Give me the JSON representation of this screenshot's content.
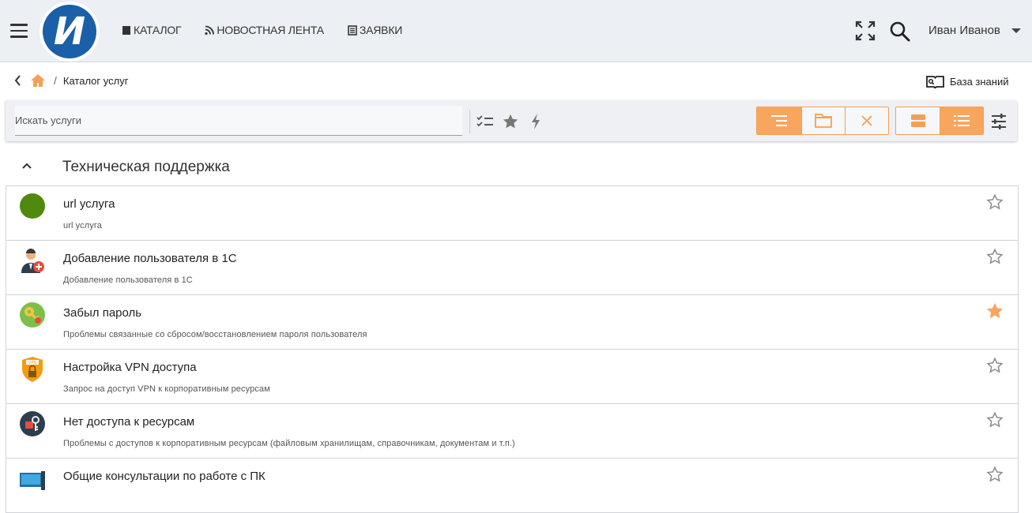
{
  "header": {
    "logo_letter": "И",
    "nav": [
      {
        "label": "КАТАЛОГ",
        "icon": "book-icon"
      },
      {
        "label": "НОВОСТНАЯ ЛЕНТА",
        "icon": "rss-icon"
      },
      {
        "label": "ЗАЯВКИ",
        "icon": "tickets-icon"
      }
    ],
    "user_name": "Иван Иванов"
  },
  "breadcrumb": {
    "current": "Каталог услуг",
    "separator": "/"
  },
  "knowledge_base": {
    "label": "База знаний"
  },
  "toolbar": {
    "search_placeholder": "Искать услуги",
    "accent_color": "#f8a65e"
  },
  "section": {
    "title": "Техническая поддержка"
  },
  "services": [
    {
      "title": "url услуга",
      "desc": "url услуга",
      "icon": "green-circle-icon",
      "favorite": false
    },
    {
      "title": "Добавление пользователя в 1С",
      "desc": "Добавление пользователя в 1С",
      "icon": "add-user-icon",
      "favorite": false
    },
    {
      "title": "Забыл пароль",
      "desc": "Проблемы связанные со сбросом/восстановлением пароля пользователя",
      "icon": "key-icon",
      "favorite": true
    },
    {
      "title": "Настройка VPN доступа",
      "desc": "Запрос на доступ VPN к корпоративным ресурсам",
      "icon": "vpn-shield-icon",
      "favorite": false
    },
    {
      "title": "Нет доступа к ресурсам",
      "desc": "Проблемы с доступов к корпоративным ресурсам (файловым хранилищам, справочникам, документам и т.п.)",
      "icon": "access-denied-icon",
      "favorite": false
    },
    {
      "title": "Общие консультации по работе с ПК",
      "desc": "",
      "icon": "computer-icon",
      "favorite": false
    }
  ]
}
